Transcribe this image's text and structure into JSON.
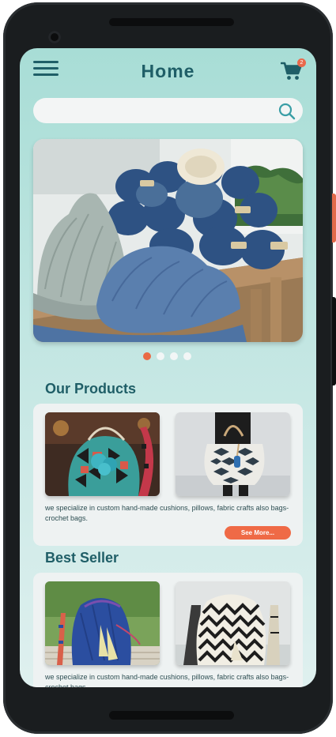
{
  "header": {
    "title": "Home",
    "cart_count": "2"
  },
  "search": {
    "placeholder": ""
  },
  "carousel": {
    "slides": 4,
    "active_index": 0
  },
  "products": {
    "title": "Our Products",
    "description": "we specialize in custom hand-made cushions, pillows, fabric crafts also bags-crochet bags.",
    "button_label": "See More..."
  },
  "best_seller": {
    "title": "Best Seller",
    "description": "we specialize in custom hand-made cushions, pillows, fabric crafts also bags-crochet bags."
  },
  "colors": {
    "primary_text": "#1f5e67",
    "accent": "#ef6a46",
    "background_top": "#a8ddd6",
    "card": "#eef2f2"
  },
  "icons": {
    "menu": "hamburger-menu-icon",
    "cart": "shopping-cart-icon",
    "search": "search-icon"
  }
}
